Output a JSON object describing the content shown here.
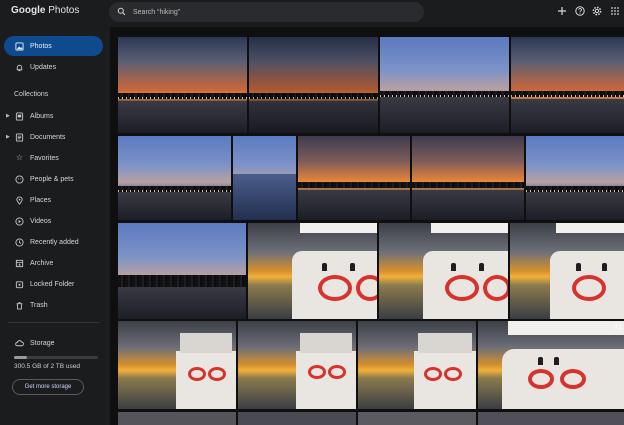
{
  "app": {
    "brand": "Google",
    "product": "Photos"
  },
  "search": {
    "placeholder": "Search “hiking”"
  },
  "top_icons": [
    "plus-icon",
    "help-icon",
    "settings-icon",
    "apps-grid-icon"
  ],
  "sidebar": {
    "items": [
      {
        "label": "Photos",
        "icon": "photo-icon",
        "active": true
      },
      {
        "label": "Updates",
        "icon": "bell-icon"
      }
    ],
    "collections_label": "Collections",
    "collections": [
      {
        "label": "Albums",
        "icon": "album-icon",
        "expandable": true
      },
      {
        "label": "Documents",
        "icon": "document-icon",
        "expandable": true
      },
      {
        "label": "Favorites",
        "icon": "star-icon"
      },
      {
        "label": "People & pets",
        "icon": "face-icon"
      },
      {
        "label": "Places",
        "icon": "pin-icon"
      },
      {
        "label": "Videos",
        "icon": "video-icon"
      },
      {
        "label": "Recently added",
        "icon": "clock-icon"
      },
      {
        "label": "Archive",
        "icon": "archive-icon"
      },
      {
        "label": "Locked Folder",
        "icon": "lock-icon"
      },
      {
        "label": "Trash",
        "icon": "trash-icon"
      }
    ],
    "storage": {
      "label": "Storage",
      "used_text": "300.5 GB of 2 TB used",
      "used_fraction": 0.15,
      "button": "Get more storage"
    }
  },
  "grid": {
    "overlay_text": "0:1"
  },
  "colors": {
    "accent": "#0e4a8e",
    "background": "#1b1c1e",
    "ring": "#d7322d"
  }
}
